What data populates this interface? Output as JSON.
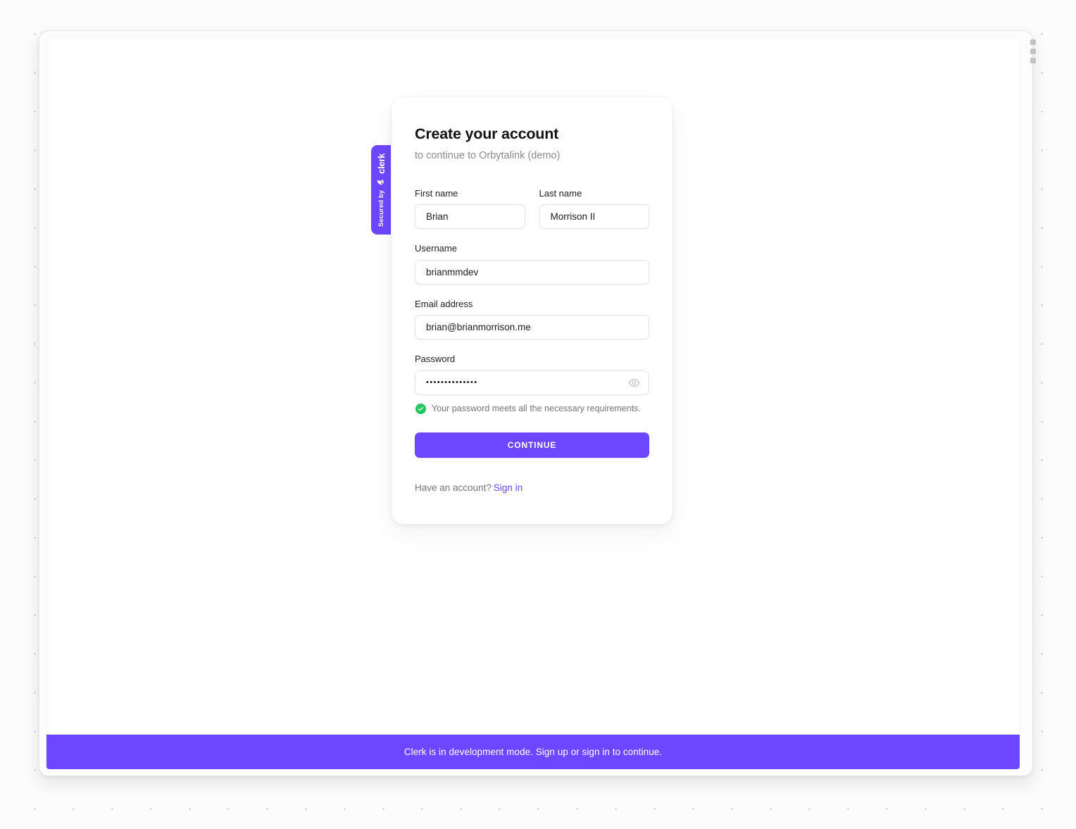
{
  "window": {
    "grip_icon": "drag-grip-icon"
  },
  "card": {
    "title": "Create your account",
    "subtitle": "to continue to Orbytalink (demo)",
    "fields": [
      {
        "label": "First name",
        "value": "Brian",
        "name": "first-name"
      },
      {
        "label": "Last name",
        "value": "Morrison II",
        "name": "last-name"
      },
      {
        "label": "Username",
        "value": "brianmmdev",
        "name": "username"
      },
      {
        "label": "Email address",
        "value": "brian@brianmorrison.me",
        "name": "email-address"
      },
      {
        "label": "Password",
        "value": "••••••••••••••",
        "name": "password"
      }
    ],
    "password_hint": "Your password meets all the necessary requirements.",
    "password_hint_icon": "check-circle-icon",
    "password_toggle_icon": "eye-icon",
    "continue_label": "CONTINUE",
    "footer_text": "Have an account?",
    "footer_link": "Sign in"
  },
  "clerk_badge": {
    "secured_text": "Secured by",
    "brand": "clerk",
    "logo_icon": "clerk-logo-icon"
  },
  "dev_banner": {
    "message": "Clerk is in development mode. Sign up or sign in to continue."
  },
  "colors": {
    "accent": "#6c47ff",
    "success": "#22c55e",
    "label": "#212126",
    "muted": "#8b8b92"
  }
}
